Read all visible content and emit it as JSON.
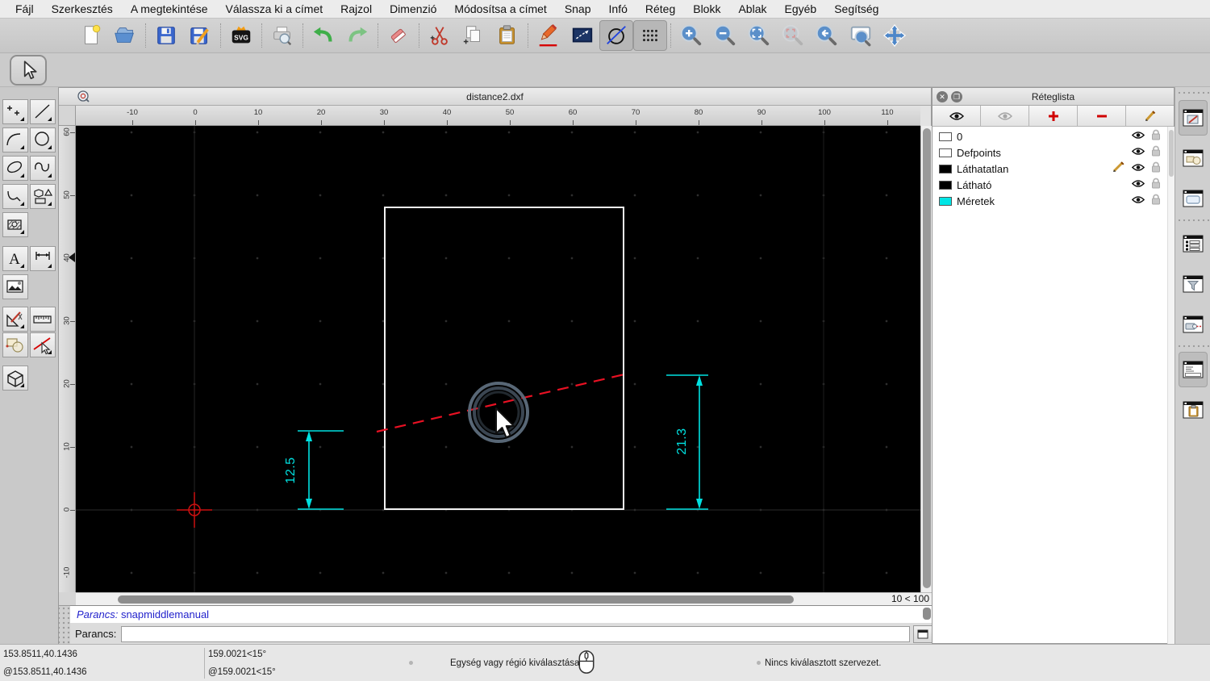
{
  "menu_bar": {
    "items": [
      "Fájl",
      "Szerkesztés",
      "A megtekintése",
      "Válassza ki a címet",
      "Rajzol",
      "Dimenzió",
      "Módosítsa a címet",
      "Snap",
      "Infó",
      "Réteg",
      "Blokk",
      "Ablak",
      "Egyéb",
      "Segítség"
    ]
  },
  "main_toolbar": {
    "icons": [
      "new-file",
      "open-file",
      "save",
      "save-as",
      "svg-export",
      "print-preview",
      "undo",
      "redo",
      "delete",
      "cut",
      "copy",
      "paste",
      "draw-order",
      "selection-window",
      "circle-line",
      "grid-toggle",
      "zoom-in",
      "zoom-out",
      "auto-zoom",
      "zoom-selection",
      "previous-view",
      "window-zoom",
      "pan"
    ]
  },
  "tool_palette": {
    "icons": [
      "selection-pointer",
      "points",
      "lines",
      "arcs",
      "circles",
      "ellipses",
      "splines",
      "polylines",
      "shapes",
      "hatches",
      "text",
      "dimensions",
      "images",
      "cad-tools",
      "measure",
      "modify",
      "snap-restriction",
      "box-3d"
    ]
  },
  "drawing_window": {
    "title": "distance2.dxf",
    "grid_status": "10 < 100"
  },
  "rulers": {
    "horizontal": [
      "-10",
      "0",
      "10",
      "20",
      "30",
      "40",
      "50",
      "60",
      "70",
      "80",
      "90",
      "100",
      "110"
    ],
    "vertical": [
      "60",
      "50",
      "40",
      "30",
      "20",
      "10",
      "0",
      "-10"
    ]
  },
  "canvas": {
    "dimension_left": "12.5",
    "dimension_right": "21.3",
    "dimension_color": "#00e1e1",
    "dashed_line_color": "#e81123",
    "rectangle_color": "#f2f2f2",
    "origin_marker_color": "#cc1111",
    "snap_indicator_color": "#51616f"
  },
  "layer_panel": {
    "title": "Réteglista",
    "toolbar_icons": [
      "show-all-layers",
      "hide-all-layers",
      "add-layer",
      "remove-layer",
      "edit-layer"
    ],
    "layers": [
      {
        "name": "0",
        "color": "#ffffff",
        "visible": true,
        "locked": false,
        "editing": false
      },
      {
        "name": "Defpoints",
        "color": "#ffffff",
        "visible": true,
        "locked": false,
        "editing": false
      },
      {
        "name": "Láthatatlan",
        "color": "#000000",
        "visible": true,
        "locked": false,
        "editing": true
      },
      {
        "name": "Látható",
        "color": "#000000",
        "visible": true,
        "locked": false,
        "editing": false
      },
      {
        "name": "Méretek",
        "color": "#00e5e5",
        "visible": true,
        "locked": false,
        "editing": false
      }
    ]
  },
  "right_dock": {
    "icons": [
      "layer-list-window",
      "block-list-window",
      "property-editor-window",
      "selection-list-window",
      "filter-window",
      "view-window",
      "command-line-window",
      "clipboard-window"
    ]
  },
  "command_line": {
    "history_label": "Parancs:",
    "history_command": "snapmiddlemanual",
    "prompt_label": "Parancs:",
    "input_value": ""
  },
  "status_bar": {
    "coordinate_absolute": "153.8511,40.1436",
    "coordinate_relative": "@153.8511,40.1436",
    "polar_absolute": "159.0021<15°",
    "polar_relative": "@159.0021<15°",
    "hint": "Egység vagy régió kiválasztása",
    "selection_info": "Nincs kiválasztott szervezet."
  }
}
